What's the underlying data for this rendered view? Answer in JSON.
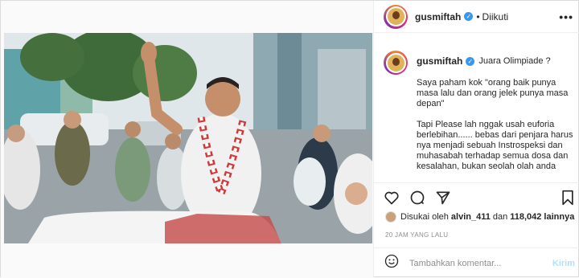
{
  "post": {
    "username": "gusmiftah",
    "follow_separator": "•",
    "follow_status": "Diikuti",
    "more": "•••"
  },
  "caption": {
    "username": "gusmiftah",
    "title": "Juara Olimpiade ?",
    "text": "Saya paham kok \"orang baik punya masa lalu dan orang jelek punya masa depan\"\n\nTapi Please lah nggak usah euforia berlebihan...... bebas dari penjara harus nya menjadi sebuah Instrospeksi dan muhasabah terhadap semua dosa dan kesalahan, bukan seolah olah anda"
  },
  "likes": {
    "prefix": "Disukai oleh",
    "user": "alvin_411",
    "joiner": "dan",
    "count": "118,042 lainnya"
  },
  "timestamp": "20 JAM YANG LALU",
  "comment": {
    "placeholder": "Tambahkan komentar...",
    "post_label": "Kirim"
  },
  "icons": [
    "heart-icon",
    "comment-icon",
    "share-icon",
    "bookmark-icon",
    "emoji-icon",
    "verified-icon",
    "more-icon"
  ]
}
